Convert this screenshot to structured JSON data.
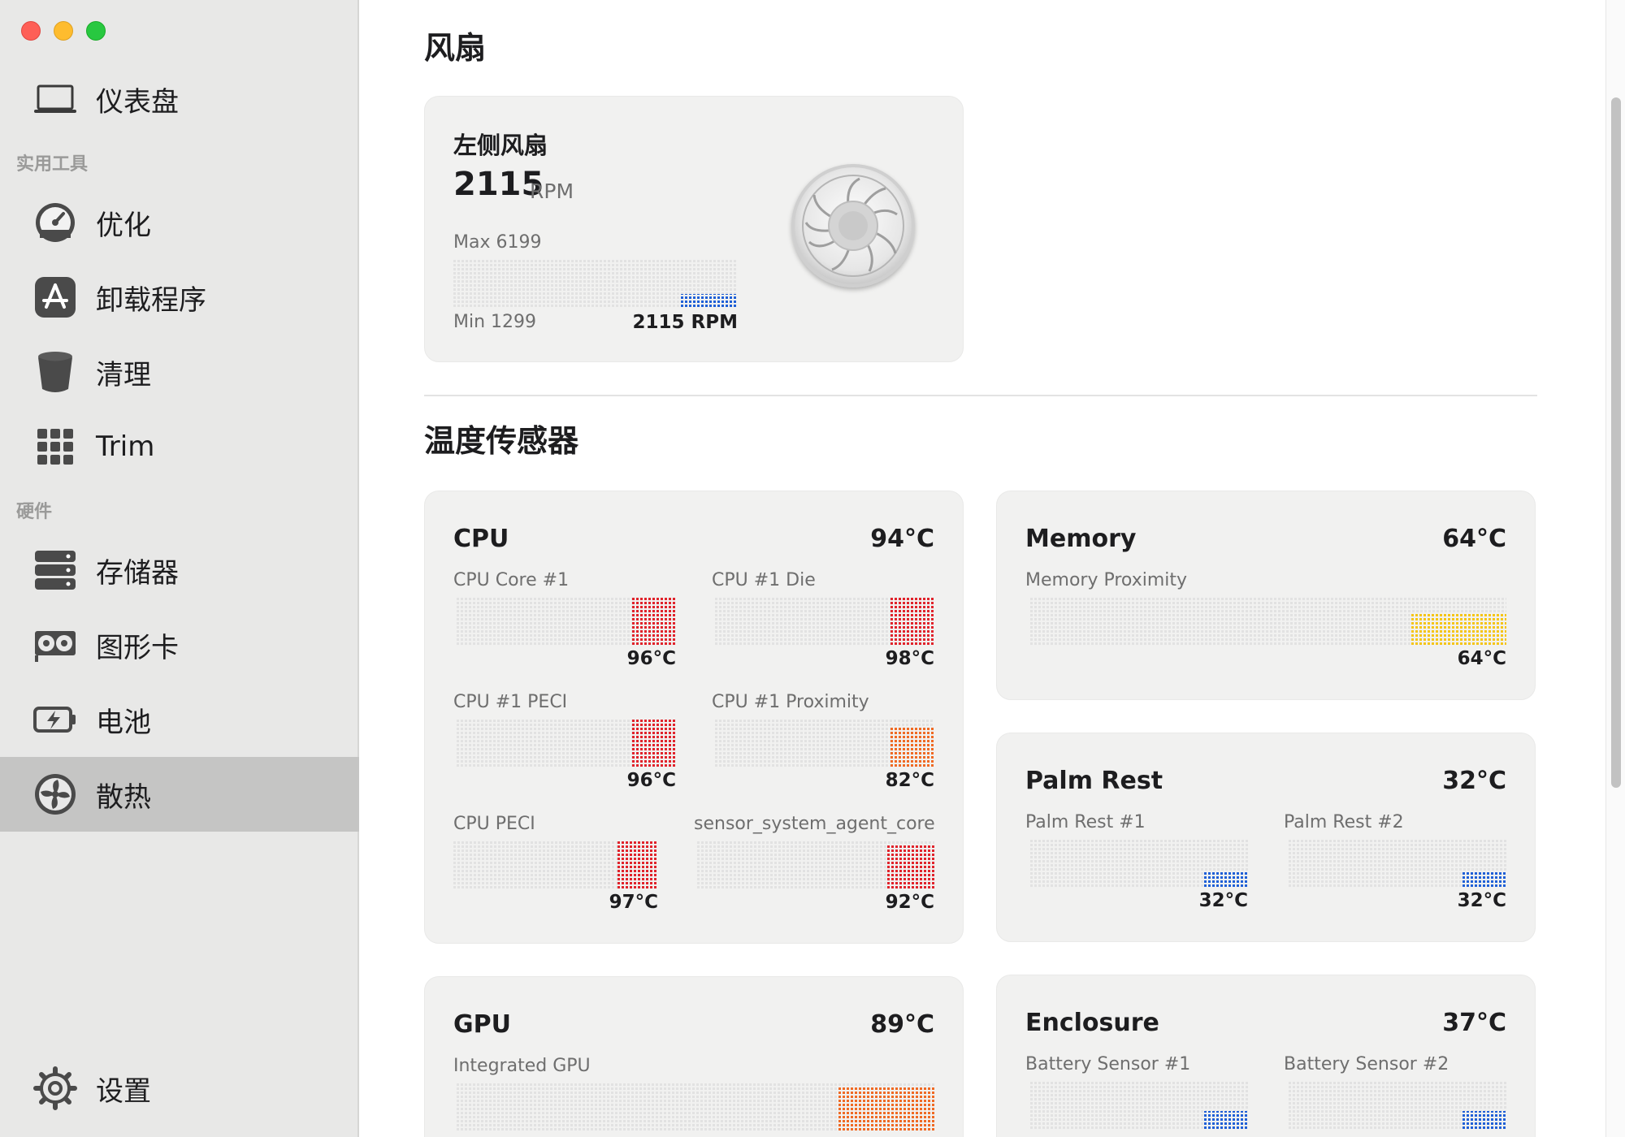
{
  "window": {
    "controls": [
      "close",
      "minimize",
      "zoom"
    ]
  },
  "sidebar": {
    "items": [
      {
        "label": "仪表盘",
        "icon": "laptop-icon"
      },
      {
        "label": "优化",
        "icon": "gauge-icon"
      },
      {
        "label": "卸载程序",
        "icon": "app-store-icon"
      },
      {
        "label": "清理",
        "icon": "trash-icon"
      },
      {
        "label": "Trim",
        "icon": "grid-icon"
      },
      {
        "label": "存储器",
        "icon": "storage-icon"
      },
      {
        "label": "图形卡",
        "icon": "graphics-card-icon"
      },
      {
        "label": "电池",
        "icon": "battery-icon"
      },
      {
        "label": "散热",
        "icon": "fan-icon",
        "active": true
      },
      {
        "label": "设置",
        "icon": "gear-icon"
      }
    ],
    "sections": {
      "tools": "实用工具",
      "hardware": "硬件"
    }
  },
  "fans": {
    "heading": "风扇",
    "left_fan": {
      "title": "左侧风扇",
      "rpm": "2115",
      "rpm_unit": "RPM",
      "max_label": "Max 6199",
      "min_label": "Min 1299",
      "current_label": "2115 RPM",
      "fill_fraction": 0.2,
      "color": "#1f5fd6"
    }
  },
  "sensors": {
    "heading": "温度传感器",
    "cpu": {
      "title": "CPU",
      "value": "94°C",
      "items": [
        {
          "label": "CPU Core #1",
          "value": "96°C",
          "level": 0.96,
          "color": "#e0232b"
        },
        {
          "label": "CPU #1 Die",
          "value": "98°C",
          "level": 0.98,
          "color": "#e0232b"
        },
        {
          "label": "CPU #1 PECI",
          "value": "96°C",
          "level": 0.96,
          "color": "#e0232b"
        },
        {
          "label": "CPU #1 Proximity",
          "value": "82°C",
          "level": 0.82,
          "color": "#ef6a24"
        },
        {
          "label": "CPU PECI",
          "value": "97°C",
          "level": 0.97,
          "color": "#e0232b"
        },
        {
          "label": "sensor_system_agent_core",
          "value": "92°C",
          "level": 0.92,
          "color": "#e0232b"
        }
      ]
    },
    "memory": {
      "title": "Memory",
      "value": "64°C",
      "items": [
        {
          "label": "Memory Proximity",
          "value": "64°C",
          "level": 0.64,
          "color": "#f5c518"
        }
      ]
    },
    "palm_rest": {
      "title": "Palm Rest",
      "value": "32°C",
      "items": [
        {
          "label": "Palm Rest #1",
          "value": "32°C",
          "level": 0.32,
          "color": "#1f5fd6"
        },
        {
          "label": "Palm Rest #2",
          "value": "32°C",
          "level": 0.32,
          "color": "#1f5fd6"
        }
      ]
    },
    "gpu": {
      "title": "GPU",
      "value": "89°C",
      "items": [
        {
          "label": "Integrated GPU",
          "level": 0.89,
          "color": "#ef6a24"
        }
      ]
    },
    "enclosure": {
      "title": "Enclosure",
      "value": "37°C",
      "items": [
        {
          "label": "Battery Sensor #1",
          "level": 0.37,
          "color": "#1f5fd6"
        },
        {
          "label": "Battery Sensor #2",
          "level": 0.37,
          "color": "#1f5fd6"
        }
      ]
    }
  }
}
